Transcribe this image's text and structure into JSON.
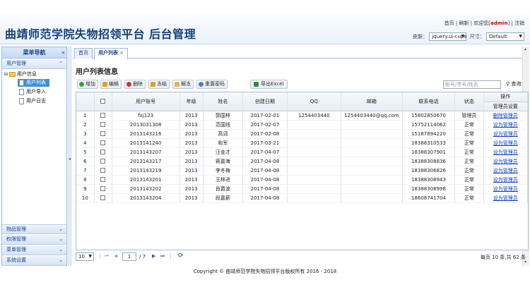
{
  "header": {
    "title": "曲靖师范学院失物招领平台 后台管理",
    "links": {
      "home": "首页",
      "refresh": "刷新",
      "welcome_prefix": "欢迎您[",
      "user": "admin",
      "welcome_suffix": "]",
      "logout": "注销"
    },
    "skin_label": "皮肤：",
    "skin_value": "jquery.ui-cupe",
    "size_label": "尺寸：",
    "size_value": "Default"
  },
  "sidebar": {
    "title": "菜单导航",
    "panels": {
      "user": "用户管理",
      "items": "物品管理",
      "perm": "权限管理",
      "menu": "菜单管理",
      "system": "系统设置"
    },
    "tree": {
      "root": "用户信息",
      "children": [
        "用户列表",
        "用户导入",
        "用户日志"
      ]
    }
  },
  "tabs": [
    {
      "label": "首页"
    },
    {
      "label": "用户列表"
    }
  ],
  "main": {
    "title": "用户列表信息",
    "toolbar": {
      "add": "增加",
      "edit": "编辑",
      "delete": "删除",
      "freeze": "冻结",
      "unfreeze": "解冻",
      "reset": "重置密码",
      "export": "导出Excel"
    },
    "search": {
      "placeholder": "账号/学号/姓名",
      "button": "查询"
    },
    "table": {
      "headers": [
        "",
        "",
        "用户账号",
        "年级",
        "姓名",
        "创建日期",
        "QQ",
        "邮箱",
        "联系电话",
        "状态",
        "操作"
      ],
      "sub_header": "管理员设置",
      "rows": [
        [
          "1",
          "fxj123",
          "2013",
          "郭国林",
          "2017-02-01",
          "1254403440",
          "1254403440@qq.com",
          "15802850670",
          "管理员",
          "删除管理员"
        ],
        [
          "2",
          "2013031308",
          "2013",
          "范国线",
          "2017-02-07",
          "",
          "",
          "15752114062",
          "正常",
          "设为管理员"
        ],
        [
          "3",
          "2013143216",
          "2013",
          "高词",
          "2017-02-08",
          "",
          "",
          "15187894220",
          "正常",
          "设为管理员"
        ],
        [
          "4",
          "2013141240",
          "2013",
          "和军",
          "2017-03-21",
          "",
          "",
          "18388310533",
          "正常",
          "设为管理员"
        ],
        [
          "5",
          "2013143207",
          "2013",
          "汪金才",
          "2017-04-07",
          "",
          "",
          "18388307901",
          "正常",
          "设为管理员"
        ],
        [
          "6",
          "2013143217",
          "2013",
          "蒋嘉海",
          "2017-04-08",
          "",
          "",
          "18388308836",
          "正常",
          "设为管理员"
        ],
        [
          "7",
          "2013143219",
          "2013",
          "李冬梅",
          "2017-04-08",
          "",
          "",
          "18388306826",
          "正常",
          "设为管理员"
        ],
        [
          "8",
          "2013143201",
          "2013",
          "王林进",
          "2017-04-08",
          "",
          "",
          "18388308943",
          "正常",
          "设为管理员"
        ],
        [
          "9",
          "2013143202",
          "2013",
          "肖爵波",
          "2017-04-08",
          "",
          "",
          "18388308998",
          "正常",
          "设为管理员"
        ],
        [
          "10",
          "2013143204",
          "2013",
          "段嘉薪",
          "2017-04-08",
          "",
          "",
          "18608741704",
          "正常",
          "设为管理员"
        ]
      ]
    }
  },
  "pager": {
    "page_size": "10",
    "page": "1",
    "total_pages": "/ 7",
    "summary": "每页 10 条,共 62 条"
  },
  "footer": "Copyright © 曲靖师范学院失物招领平台版权所有  2016 - 2018",
  "colors": {
    "accent": "#3d90db",
    "link": "#0a3cc4",
    "title": "#16417a"
  }
}
